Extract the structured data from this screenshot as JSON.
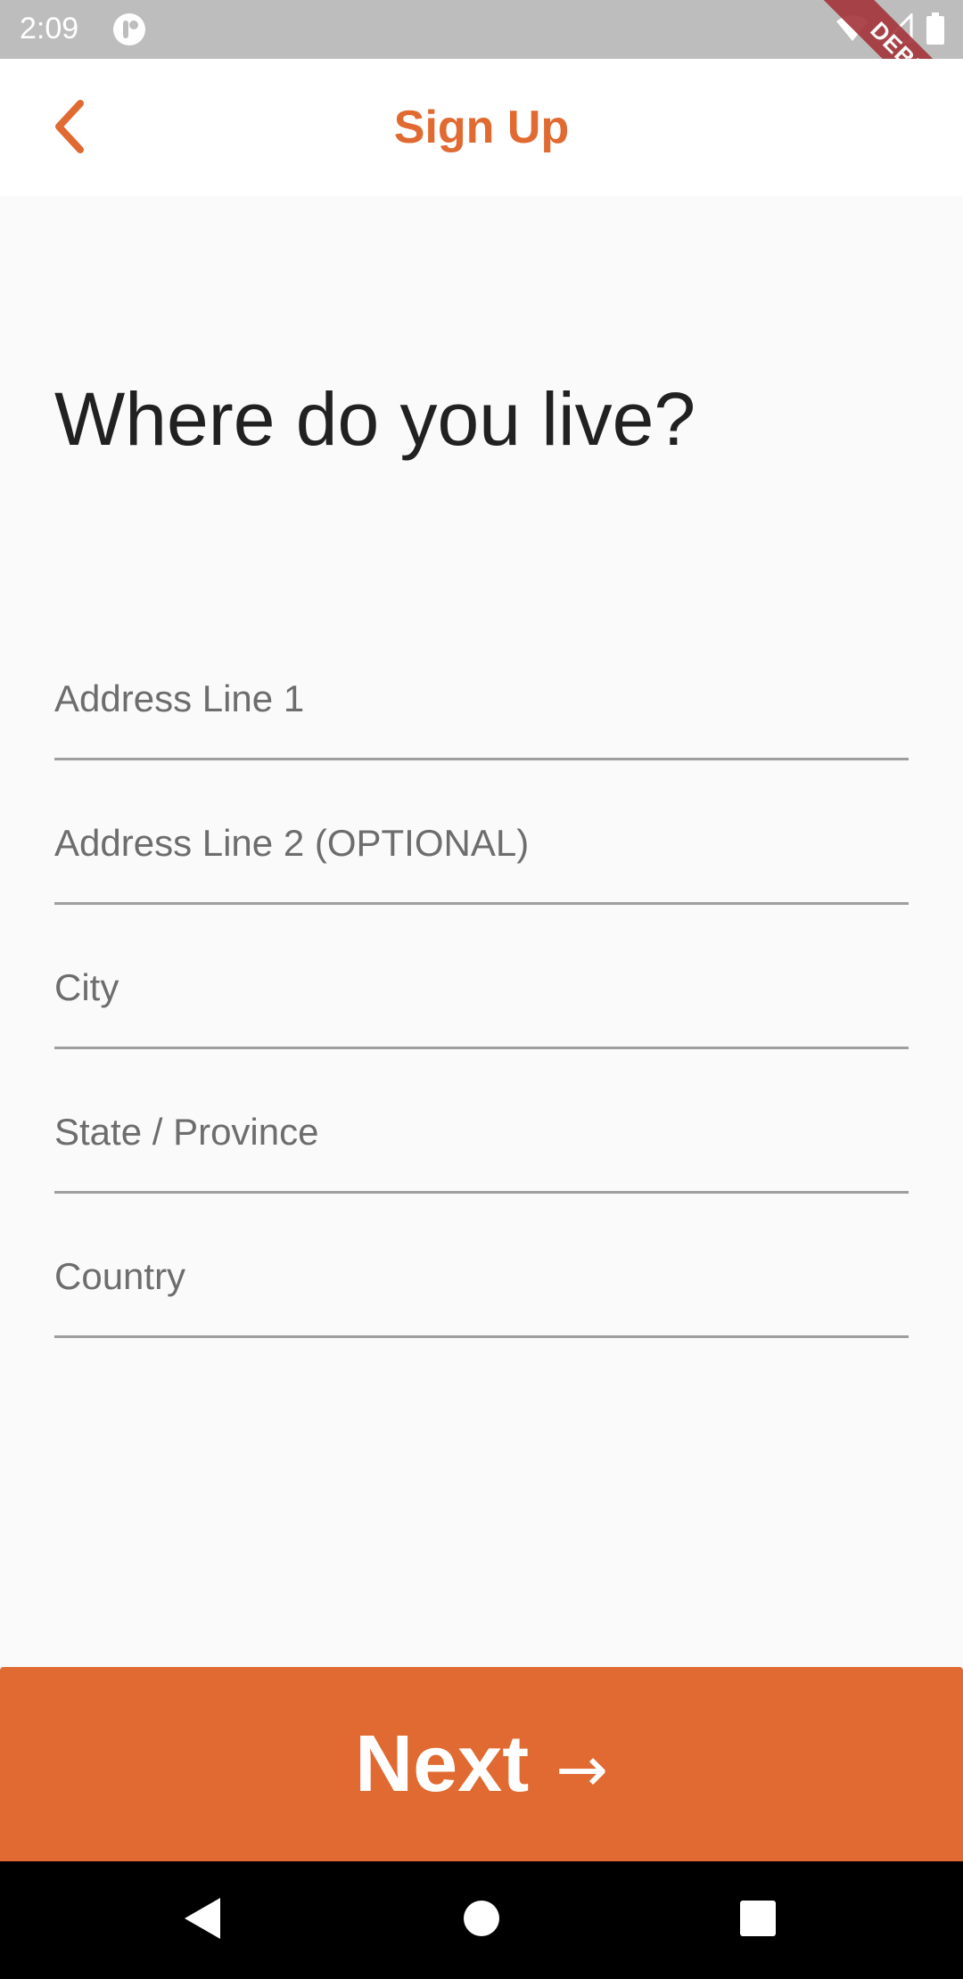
{
  "status_bar": {
    "time": "2:09",
    "debug_label": "DEBUG",
    "icons": [
      "app-notification-icon",
      "wifi-icon",
      "cell-signal-icon",
      "battery-icon"
    ]
  },
  "app_bar": {
    "title": "Sign Up",
    "back_icon": "chevron-left-icon"
  },
  "main": {
    "heading": "Where do you live?",
    "fields": [
      {
        "placeholder": "Address Line 1",
        "value": ""
      },
      {
        "placeholder": "Address Line 2 (OPTIONAL)",
        "value": ""
      },
      {
        "placeholder": "City",
        "value": ""
      },
      {
        "placeholder": "State / Province",
        "value": ""
      },
      {
        "placeholder": "Country",
        "value": ""
      }
    ]
  },
  "next_button": {
    "label": "Next",
    "arrow": "→"
  },
  "nav_bar": {
    "icons": [
      "back-triangle-icon",
      "home-circle-icon",
      "recents-square-icon"
    ]
  },
  "colors": {
    "accent": "#e06a31",
    "status_bar": "#bdbdbd",
    "background": "#fafafa",
    "debug_ribbon": "#a5383e"
  }
}
